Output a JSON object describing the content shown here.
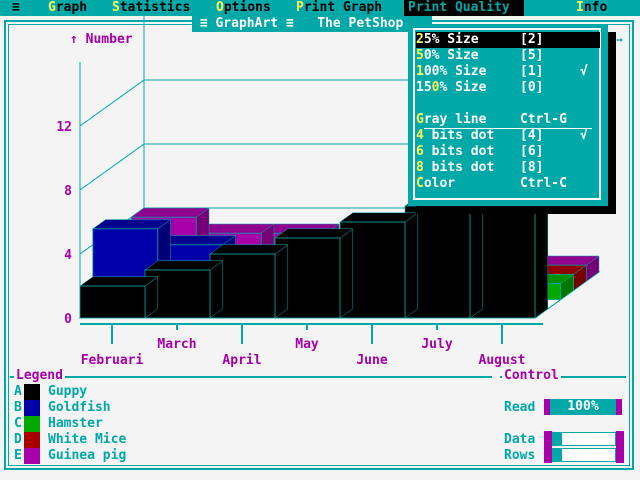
{
  "menu": {
    "system": "≡",
    "graph": {
      "hk": "G",
      "rest": "raph"
    },
    "statistics": {
      "hk": "S",
      "rest": "tatistics"
    },
    "options": {
      "hk": "O",
      "rest": "ptions"
    },
    "print_graph": {
      "hk": "P",
      "rest": "rint Graph"
    },
    "print_quality": "Print Quality",
    "info": {
      "hk": "I",
      "rest": "nfo"
    }
  },
  "window_title": " ≡ GraphArt ≡   The PetShop",
  "chart_data": {
    "type": "bar",
    "ylabel": "↑ Number",
    "y_ticks": [
      "0",
      "4",
      "8",
      "12"
    ],
    "ylim": [
      0,
      16
    ],
    "categories": [
      "Februari",
      "March",
      "April",
      "May",
      "June",
      "July",
      "August"
    ],
    "series": [
      {
        "name": "Guppy",
        "values": [
          2,
          3,
          4,
          5,
          6,
          7,
          7
        ],
        "color": "#000000"
      },
      {
        "name": "Goldfish",
        "values": [
          5,
          4,
          3,
          2,
          1,
          0,
          0
        ],
        "color": "#0000a8"
      },
      {
        "name": "Hamster",
        "values": [
          1,
          1,
          1,
          1,
          1,
          1,
          1
        ],
        "color": "#00a800"
      },
      {
        "name": "White Mice",
        "values": [
          1,
          1,
          1,
          1,
          1,
          1,
          1
        ],
        "color": "#a80000"
      },
      {
        "name": "Guinea pig",
        "values": [
          4,
          3,
          3,
          2,
          1,
          1,
          1
        ],
        "color": "#a800a8"
      }
    ]
  },
  "legend": {
    "title": "Legend",
    "items": [
      {
        "key": "A",
        "label": "Guppy",
        "color": "#000000"
      },
      {
        "key": "B",
        "label": "Goldfish",
        "color": "#0000a8"
      },
      {
        "key": "C",
        "label": "Hamster",
        "color": "#00a800"
      },
      {
        "key": "D",
        "label": "White Mice",
        "color": "#a80000"
      },
      {
        "key": "E",
        "label": "Guinea pig",
        "color": "#a800a8"
      }
    ]
  },
  "control": {
    "title": "Control",
    "read_label": "Read",
    "read_value": "100%",
    "data_label": "Data",
    "data_fraction": 0.15,
    "rows_label": "Rows",
    "rows_fraction": 0.15
  },
  "dropdown": {
    "items": [
      {
        "hk": "2",
        "pre": "",
        "post": "5% Size",
        "key": "[2]",
        "check": "",
        "selected": true
      },
      {
        "hk": "5",
        "pre": "",
        "post": "0% Size",
        "key": "[5]",
        "check": "",
        "selected": false
      },
      {
        "hk": "1",
        "pre": "",
        "post": "00% Size",
        "key": "[1]",
        "check": "√",
        "selected": false
      },
      {
        "hk": "0",
        "pre": "15",
        "post": "% Size",
        "key": "[0]",
        "check": "",
        "selected": false
      },
      {
        "hk": "G",
        "pre": "",
        "post": "ray line",
        "key": "Ctrl-G",
        "check": "",
        "selected": false
      },
      {
        "hk": "4",
        "pre": "",
        "post": " bits dot",
        "key": "[4]",
        "check": "√",
        "selected": false
      },
      {
        "hk": "6",
        "pre": "",
        "post": " bits dot",
        "key": "[6]",
        "check": "",
        "selected": false
      },
      {
        "hk": "8",
        "pre": "",
        "post": " bits dot",
        "key": "[8]",
        "check": "",
        "selected": false
      },
      {
        "hk": "C",
        "pre": "",
        "post": "olor",
        "key": "Ctrl-C",
        "check": "",
        "selected": false
      }
    ]
  }
}
